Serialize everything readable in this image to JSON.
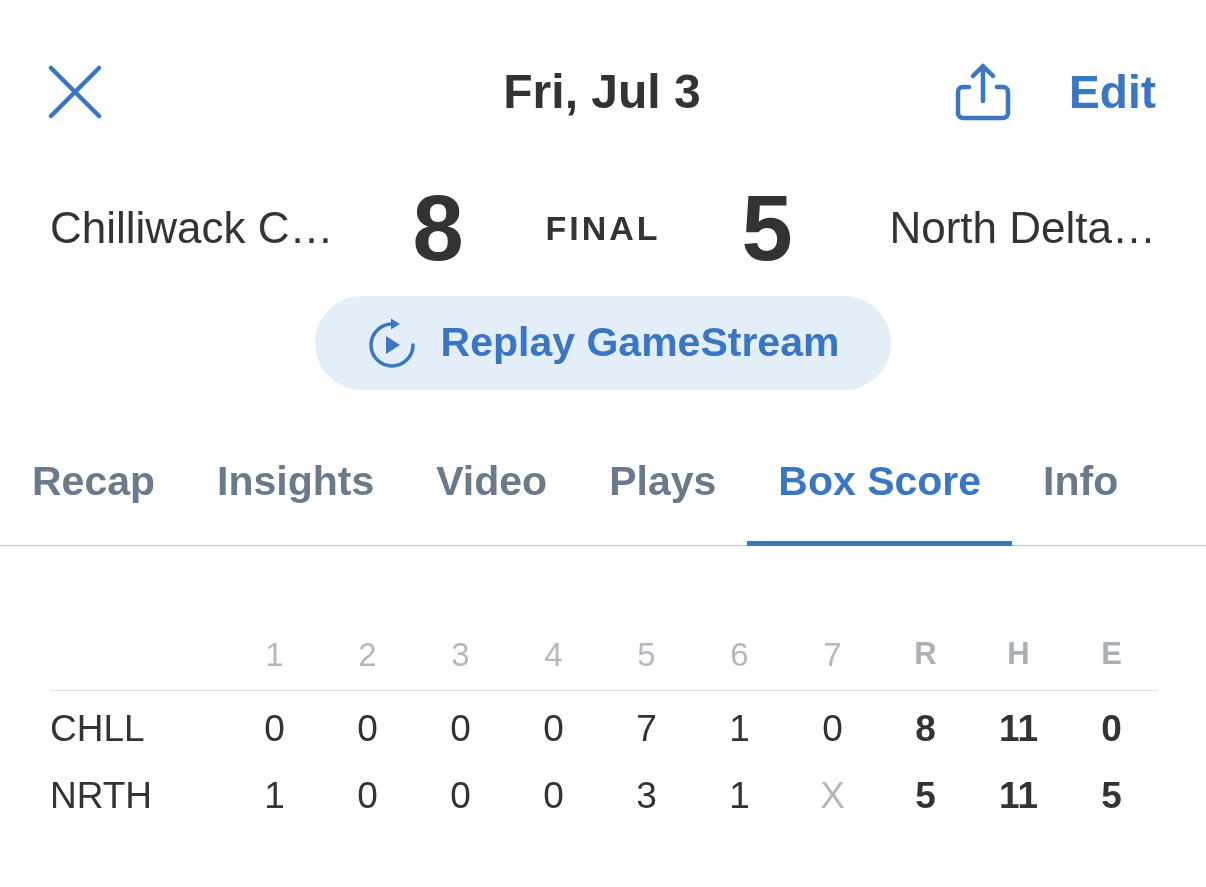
{
  "header": {
    "title": "Fri, Jul 3",
    "edit_label": "Edit"
  },
  "score": {
    "away": {
      "name": "Chilliwack C…",
      "runs": "8"
    },
    "status": "FINAL",
    "home": {
      "name": "North Delta…",
      "runs": "5"
    }
  },
  "replay_button": {
    "label": "Replay GameStream"
  },
  "tabs": [
    {
      "label": "Recap",
      "selected": false
    },
    {
      "label": "Insights",
      "selected": false
    },
    {
      "label": "Video",
      "selected": false
    },
    {
      "label": "Plays",
      "selected": false
    },
    {
      "label": "Box Score",
      "selected": true
    },
    {
      "label": "Info",
      "selected": false
    }
  ],
  "box_score": {
    "columns": [
      {
        "label": "1",
        "kind": "inning"
      },
      {
        "label": "2",
        "kind": "inning"
      },
      {
        "label": "3",
        "kind": "inning"
      },
      {
        "label": "4",
        "kind": "inning"
      },
      {
        "label": "5",
        "kind": "inning"
      },
      {
        "label": "6",
        "kind": "inning"
      },
      {
        "label": "7",
        "kind": "inning"
      },
      {
        "label": "R",
        "kind": "total"
      },
      {
        "label": "H",
        "kind": "total"
      },
      {
        "label": "E",
        "kind": "total"
      }
    ],
    "rows": [
      {
        "team": "CHLL",
        "cells": [
          {
            "value": "0",
            "muted": false
          },
          {
            "value": "0",
            "muted": false
          },
          {
            "value": "0",
            "muted": false
          },
          {
            "value": "0",
            "muted": false
          },
          {
            "value": "7",
            "muted": false
          },
          {
            "value": "1",
            "muted": false
          },
          {
            "value": "0",
            "muted": false
          },
          {
            "value": "8",
            "muted": false
          },
          {
            "value": "11",
            "muted": false
          },
          {
            "value": "0",
            "muted": false
          }
        ]
      },
      {
        "team": "NRTH",
        "cells": [
          {
            "value": "1",
            "muted": false
          },
          {
            "value": "0",
            "muted": false
          },
          {
            "value": "0",
            "muted": false
          },
          {
            "value": "0",
            "muted": false
          },
          {
            "value": "3",
            "muted": false
          },
          {
            "value": "1",
            "muted": false
          },
          {
            "value": "X",
            "muted": true
          },
          {
            "value": "5",
            "muted": false
          },
          {
            "value": "11",
            "muted": false
          },
          {
            "value": "5",
            "muted": false
          }
        ]
      }
    ]
  }
}
